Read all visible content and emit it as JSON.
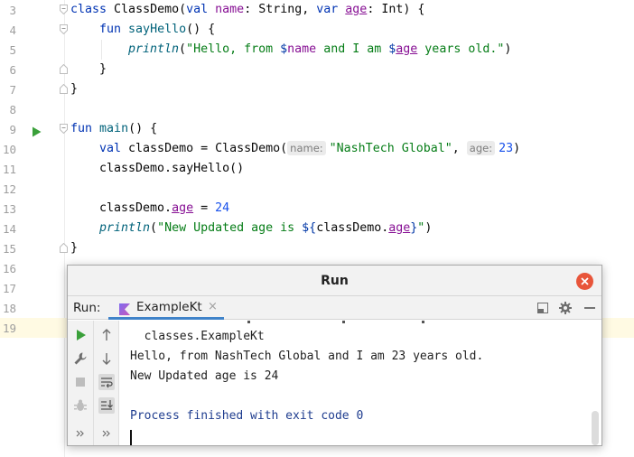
{
  "editor": {
    "lines": [
      {
        "num": "3"
      },
      {
        "num": "4"
      },
      {
        "num": "5"
      },
      {
        "num": "6"
      },
      {
        "num": "7"
      },
      {
        "num": "8"
      },
      {
        "num": "9"
      },
      {
        "num": "10"
      },
      {
        "num": "11"
      },
      {
        "num": "12"
      },
      {
        "num": "13"
      },
      {
        "num": "14"
      },
      {
        "num": "15"
      },
      {
        "num": "16"
      },
      {
        "num": "17"
      },
      {
        "num": "18"
      },
      {
        "num": "19"
      }
    ],
    "code": {
      "l3": {
        "kw_class": "class",
        "name": "ClassDemo(",
        "val": "val",
        "p1": "name",
        "t1": ": String, ",
        "var": "var",
        "p2": "age",
        "t2": ": Int) {"
      },
      "l4": {
        "kw": "fun",
        "name": "sayHello",
        "rest": "() {"
      },
      "l5": {
        "fn": "println",
        "open": "(",
        "s1": "\"Hello, from ",
        "d1": "$",
        "p1": "name",
        "s2": " and I am ",
        "d2": "$",
        "p2": "age",
        "s3": " years old.\"",
        "close": ")"
      },
      "l6": {
        "text": "}"
      },
      "l7": {
        "text": "}"
      },
      "l9": {
        "kw": "fun",
        "name": "main",
        "rest": "() {"
      },
      "l10": {
        "kw": "val",
        "text": " classDemo = ClassDemo(",
        "hint1": "name:",
        "s1": "\"NashTech Global\"",
        "comma": ", ",
        "hint2": "age:",
        "n1": "23",
        "close": ")"
      },
      "l11": {
        "text": "classDemo.sayHello()"
      },
      "l13": {
        "obj": "classDemo.",
        "p": "age",
        "eq": " = ",
        "n": "24"
      },
      "l14": {
        "fn": "println",
        "open": "(",
        "s1": "\"New Updated age is ",
        "t1": "${",
        "obj": "classDemo.",
        "p": "age",
        "t2": "}",
        "s2": "\"",
        "close": ")"
      },
      "l15": {
        "text": "}"
      }
    }
  },
  "run_window": {
    "title": "Run",
    "run_label": "Run:",
    "tab_label": "ExampleKt",
    "tab_close": "×",
    "console": [
      "  classes.ExampleKt",
      "Hello, from NashTech Global and I am 23 years old.",
      "New Updated age is 24",
      "",
      "Process finished with exit code 0"
    ]
  },
  "colors": {
    "keyword": "#0033b3",
    "string": "#067d17",
    "number": "#1750eb",
    "property": "#871094",
    "close_button": "#e8553a",
    "run_icon": "#3aa03a",
    "tab_underline": "#4083c9"
  },
  "icons": [
    "run-gutter-icon",
    "fold-icon",
    "close-icon",
    "kotlin-icon",
    "restore-layout-icon",
    "settings-gear-icon",
    "minimize-icon",
    "rerun-icon",
    "wrench-icon",
    "stop-icon",
    "debug-icon",
    "scroll-up-icon",
    "scroll-down-icon",
    "soft-wrap-icon",
    "scroll-to-end-icon",
    "more-chevron-icon"
  ]
}
